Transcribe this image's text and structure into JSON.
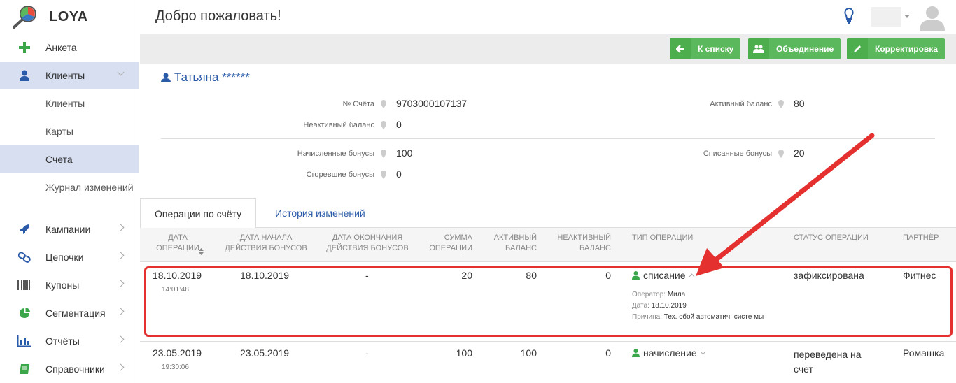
{
  "app": {
    "brand": "LOYA",
    "header_title": "Добро пожаловать!"
  },
  "sidebar": {
    "items": [
      {
        "label": "Анкета",
        "icon": "plus-icon"
      },
      {
        "label": "Клиенты",
        "icon": "user-icon"
      },
      {
        "label": "Клиенты"
      },
      {
        "label": "Карты"
      },
      {
        "label": "Счета"
      },
      {
        "label": "Журнал изменений"
      },
      {
        "label": "Кампании",
        "icon": "rocket-icon"
      },
      {
        "label": "Цепочки",
        "icon": "link-icon"
      },
      {
        "label": "Купоны",
        "icon": "barcode-icon"
      },
      {
        "label": "Сегментация",
        "icon": "pie-chart-icon"
      },
      {
        "label": "Отчёты",
        "icon": "bar-chart-icon"
      },
      {
        "label": "Справочники",
        "icon": "book-icon"
      }
    ]
  },
  "toolbar": {
    "back_label": "К списку",
    "merge_label": "Объединение",
    "adjust_label": "Корректировка"
  },
  "account": {
    "name": "Татьяна ******",
    "account_no_label": "№ Счёта",
    "account_no": "9703000107137",
    "active_balance_label": "Активный баланс",
    "active_balance": "80",
    "inactive_balance_label": "Неактивный баланс",
    "inactive_balance": "0",
    "accrued_label": "Начисленные бонусы",
    "accrued": "100",
    "spent_label": "Списанные бонусы",
    "spent": "20",
    "burned_label": "Сгоревшие бонусы",
    "burned": "0"
  },
  "tabs": {
    "operations": "Операции по счёту",
    "history": "История изменений"
  },
  "table": {
    "headers": [
      "Дата операции",
      "Дата начала действия бонусов",
      "Дата окончания действия бонусов",
      "Сумма операции",
      "Активный баланс",
      "Неактивный баланс",
      "Тип операции",
      "Статус операции",
      "Партнёр"
    ],
    "rows": [
      {
        "date": "18.10.2019",
        "time": "14:01:48",
        "start": "18.10.2019",
        "end": "-",
        "amount": "20",
        "active": "80",
        "inactive": "0",
        "type": "списание",
        "status": "зафиксирована",
        "partner": "Фитнес",
        "operator_label": "Оператор:",
        "operator": "Мила",
        "date_label": "Дата:",
        "date_value": "18.10.2019",
        "reason_label": "Причина:",
        "reason": "Тех. сбой автоматич. систе мы"
      },
      {
        "date": "23.05.2019",
        "time": "19:30:06",
        "start": "23.05.2019",
        "end": "-",
        "amount": "100",
        "active": "100",
        "inactive": "0",
        "type": "начисление",
        "status": "переведена на счет",
        "partner": "Ромашка"
      }
    ]
  },
  "colors": {
    "accent_green": "#5cb85c",
    "link_blue": "#2a5aa8",
    "highlight_red": "#e53030",
    "sidebar_active": "#d8dff0"
  }
}
